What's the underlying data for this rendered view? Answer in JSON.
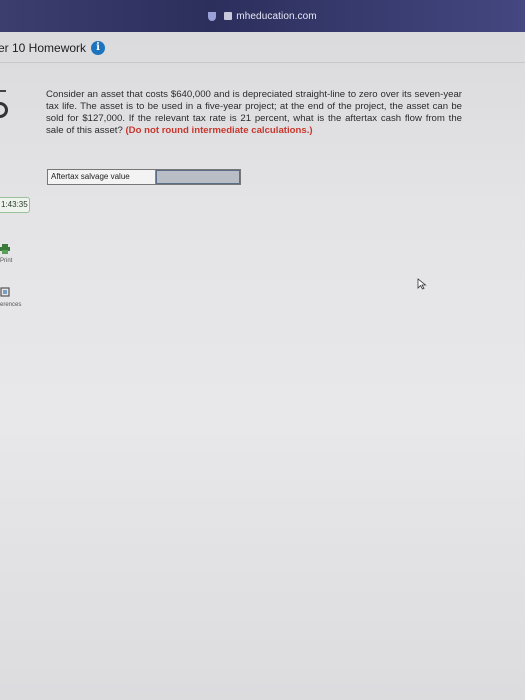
{
  "browser": {
    "url_visible": "mheducation.com"
  },
  "header": {
    "title": "er 10 Homework",
    "info_icon": "i"
  },
  "sidebar": {
    "timer": "1:43:35",
    "print_label": "Print",
    "references_label": "erences"
  },
  "question": {
    "text": "Consider an asset that costs $640,000 and is depreciated straight-line to zero over its seven-year tax life. The asset is to be used in a five-year project; at the end of the project, the asset can be sold for $127,000. If the relevant tax rate is 21 percent, what is the aftertax cash flow from the sale of this asset?",
    "note": "(Do not round intermediate calculations.)"
  },
  "answer": {
    "label": "Aftertax salvage value",
    "value": ""
  },
  "colors": {
    "url_bar": "#2c2f5c",
    "info_icon": "#1e73be",
    "note_red": "#c8372d"
  }
}
